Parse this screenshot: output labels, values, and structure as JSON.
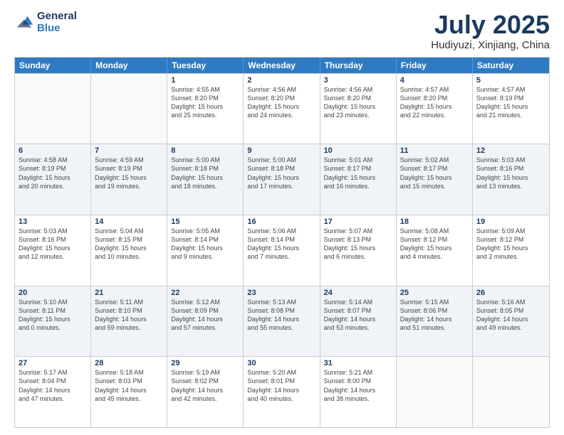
{
  "header": {
    "logo_general": "General",
    "logo_blue": "Blue",
    "title": "July 2025",
    "location": "Hudiyuzi, Xinjiang, China"
  },
  "days_of_week": [
    "Sunday",
    "Monday",
    "Tuesday",
    "Wednesday",
    "Thursday",
    "Friday",
    "Saturday"
  ],
  "weeks": [
    [
      {
        "day": "",
        "lines": []
      },
      {
        "day": "",
        "lines": []
      },
      {
        "day": "1",
        "lines": [
          "Sunrise: 4:55 AM",
          "Sunset: 8:20 PM",
          "Daylight: 15 hours",
          "and 25 minutes."
        ]
      },
      {
        "day": "2",
        "lines": [
          "Sunrise: 4:56 AM",
          "Sunset: 8:20 PM",
          "Daylight: 15 hours",
          "and 24 minutes."
        ]
      },
      {
        "day": "3",
        "lines": [
          "Sunrise: 4:56 AM",
          "Sunset: 8:20 PM",
          "Daylight: 15 hours",
          "and 23 minutes."
        ]
      },
      {
        "day": "4",
        "lines": [
          "Sunrise: 4:57 AM",
          "Sunset: 8:20 PM",
          "Daylight: 15 hours",
          "and 22 minutes."
        ]
      },
      {
        "day": "5",
        "lines": [
          "Sunrise: 4:57 AM",
          "Sunset: 8:19 PM",
          "Daylight: 15 hours",
          "and 21 minutes."
        ]
      }
    ],
    [
      {
        "day": "6",
        "lines": [
          "Sunrise: 4:58 AM",
          "Sunset: 8:19 PM",
          "Daylight: 15 hours",
          "and 20 minutes."
        ]
      },
      {
        "day": "7",
        "lines": [
          "Sunrise: 4:59 AM",
          "Sunset: 8:19 PM",
          "Daylight: 15 hours",
          "and 19 minutes."
        ]
      },
      {
        "day": "8",
        "lines": [
          "Sunrise: 5:00 AM",
          "Sunset: 8:18 PM",
          "Daylight: 15 hours",
          "and 18 minutes."
        ]
      },
      {
        "day": "9",
        "lines": [
          "Sunrise: 5:00 AM",
          "Sunset: 8:18 PM",
          "Daylight: 15 hours",
          "and 17 minutes."
        ]
      },
      {
        "day": "10",
        "lines": [
          "Sunrise: 5:01 AM",
          "Sunset: 8:17 PM",
          "Daylight: 15 hours",
          "and 16 minutes."
        ]
      },
      {
        "day": "11",
        "lines": [
          "Sunrise: 5:02 AM",
          "Sunset: 8:17 PM",
          "Daylight: 15 hours",
          "and 15 minutes."
        ]
      },
      {
        "day": "12",
        "lines": [
          "Sunrise: 5:03 AM",
          "Sunset: 8:16 PM",
          "Daylight: 15 hours",
          "and 13 minutes."
        ]
      }
    ],
    [
      {
        "day": "13",
        "lines": [
          "Sunrise: 5:03 AM",
          "Sunset: 8:16 PM",
          "Daylight: 15 hours",
          "and 12 minutes."
        ]
      },
      {
        "day": "14",
        "lines": [
          "Sunrise: 5:04 AM",
          "Sunset: 8:15 PM",
          "Daylight: 15 hours",
          "and 10 minutes."
        ]
      },
      {
        "day": "15",
        "lines": [
          "Sunrise: 5:05 AM",
          "Sunset: 8:14 PM",
          "Daylight: 15 hours",
          "and 9 minutes."
        ]
      },
      {
        "day": "16",
        "lines": [
          "Sunrise: 5:06 AM",
          "Sunset: 8:14 PM",
          "Daylight: 15 hours",
          "and 7 minutes."
        ]
      },
      {
        "day": "17",
        "lines": [
          "Sunrise: 5:07 AM",
          "Sunset: 8:13 PM",
          "Daylight: 15 hours",
          "and 6 minutes."
        ]
      },
      {
        "day": "18",
        "lines": [
          "Sunrise: 5:08 AM",
          "Sunset: 8:12 PM",
          "Daylight: 15 hours",
          "and 4 minutes."
        ]
      },
      {
        "day": "19",
        "lines": [
          "Sunrise: 5:09 AM",
          "Sunset: 8:12 PM",
          "Daylight: 15 hours",
          "and 2 minutes."
        ]
      }
    ],
    [
      {
        "day": "20",
        "lines": [
          "Sunrise: 5:10 AM",
          "Sunset: 8:11 PM",
          "Daylight: 15 hours",
          "and 0 minutes."
        ]
      },
      {
        "day": "21",
        "lines": [
          "Sunrise: 5:11 AM",
          "Sunset: 8:10 PM",
          "Daylight: 14 hours",
          "and 59 minutes."
        ]
      },
      {
        "day": "22",
        "lines": [
          "Sunrise: 5:12 AM",
          "Sunset: 8:09 PM",
          "Daylight: 14 hours",
          "and 57 minutes."
        ]
      },
      {
        "day": "23",
        "lines": [
          "Sunrise: 5:13 AM",
          "Sunset: 8:08 PM",
          "Daylight: 14 hours",
          "and 55 minutes."
        ]
      },
      {
        "day": "24",
        "lines": [
          "Sunrise: 5:14 AM",
          "Sunset: 8:07 PM",
          "Daylight: 14 hours",
          "and 53 minutes."
        ]
      },
      {
        "day": "25",
        "lines": [
          "Sunrise: 5:15 AM",
          "Sunset: 8:06 PM",
          "Daylight: 14 hours",
          "and 51 minutes."
        ]
      },
      {
        "day": "26",
        "lines": [
          "Sunrise: 5:16 AM",
          "Sunset: 8:05 PM",
          "Daylight: 14 hours",
          "and 49 minutes."
        ]
      }
    ],
    [
      {
        "day": "27",
        "lines": [
          "Sunrise: 5:17 AM",
          "Sunset: 8:04 PM",
          "Daylight: 14 hours",
          "and 47 minutes."
        ]
      },
      {
        "day": "28",
        "lines": [
          "Sunrise: 5:18 AM",
          "Sunset: 8:03 PM",
          "Daylight: 14 hours",
          "and 45 minutes."
        ]
      },
      {
        "day": "29",
        "lines": [
          "Sunrise: 5:19 AM",
          "Sunset: 8:02 PM",
          "Daylight: 14 hours",
          "and 42 minutes."
        ]
      },
      {
        "day": "30",
        "lines": [
          "Sunrise: 5:20 AM",
          "Sunset: 8:01 PM",
          "Daylight: 14 hours",
          "and 40 minutes."
        ]
      },
      {
        "day": "31",
        "lines": [
          "Sunrise: 5:21 AM",
          "Sunset: 8:00 PM",
          "Daylight: 14 hours",
          "and 38 minutes."
        ]
      },
      {
        "day": "",
        "lines": []
      },
      {
        "day": "",
        "lines": []
      }
    ]
  ]
}
